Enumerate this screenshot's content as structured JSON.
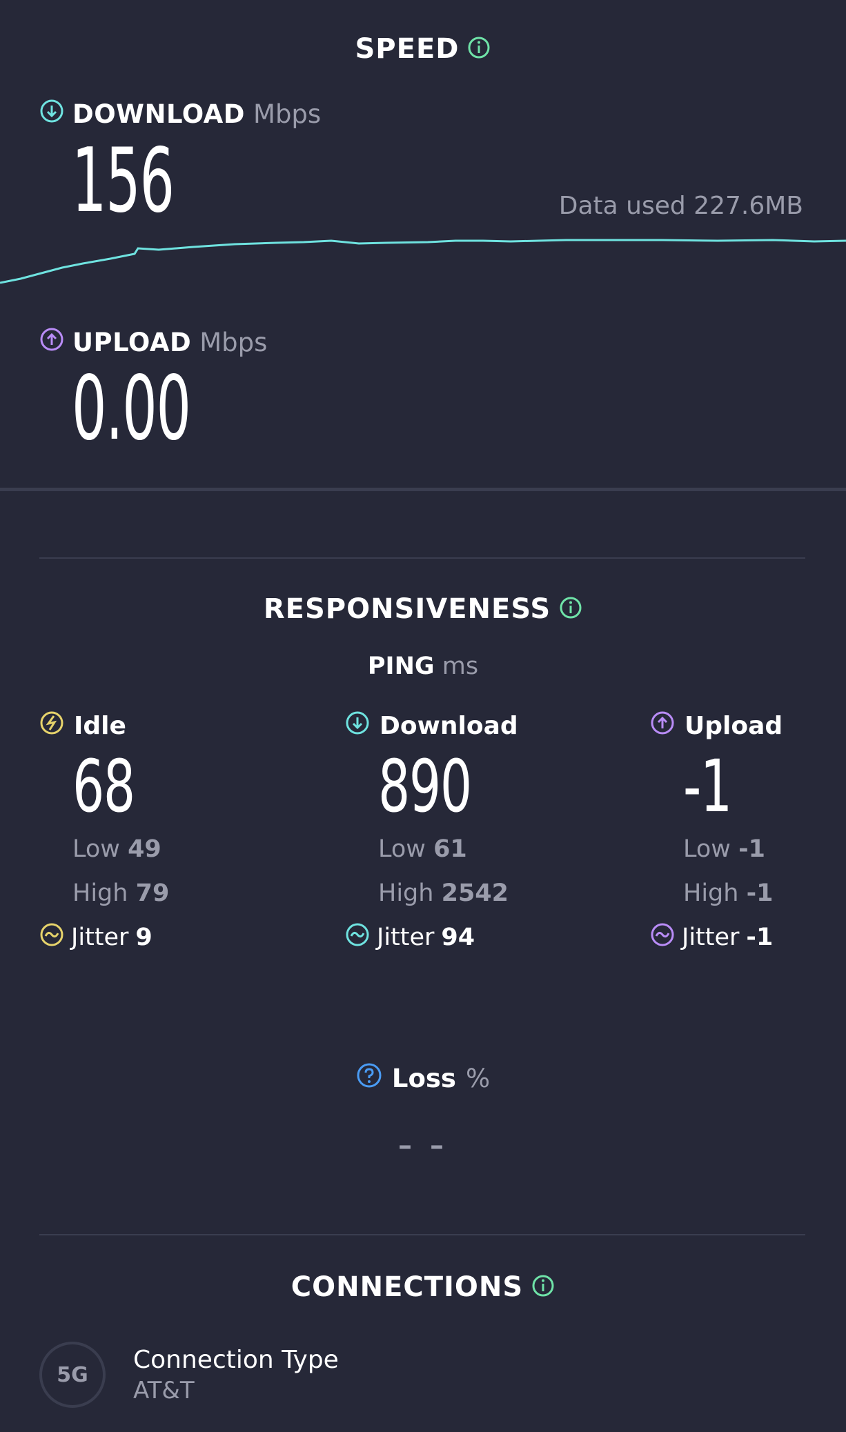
{
  "speed": {
    "title": "SPEED",
    "download": {
      "label": "DOWNLOAD",
      "unit": "Mbps",
      "value": "156",
      "data_used": "Data used 227.6MB"
    },
    "upload": {
      "label": "UPLOAD",
      "unit": "Mbps",
      "value": "0.00"
    }
  },
  "responsiveness": {
    "title": "RESPONSIVENESS",
    "ping_label": "PING",
    "ping_unit": "ms",
    "columns": [
      {
        "name": "Idle",
        "value": "68",
        "low_label": "Low",
        "low": "49",
        "high_label": "High",
        "high": "79",
        "jitter_label": "Jitter",
        "jitter": "9",
        "color": "#e6d36b",
        "icon": "lightning-icon"
      },
      {
        "name": "Download",
        "value": "890",
        "low_label": "Low",
        "low": "61",
        "high_label": "High",
        "high": "2542",
        "jitter_label": "Jitter",
        "jitter": "94",
        "color": "#6fe3e0",
        "icon": "arrow-down-icon"
      },
      {
        "name": "Upload",
        "value": "-1",
        "low_label": "Low",
        "low": "-1",
        "high_label": "High",
        "high": "-1",
        "jitter_label": "Jitter",
        "jitter": "-1",
        "color": "#b98cf7",
        "icon": "arrow-up-icon"
      }
    ],
    "loss": {
      "label": "Loss",
      "unit": "%",
      "value": "– –"
    }
  },
  "connections": {
    "title": "CONNECTIONS",
    "badge": "5G",
    "type_label": "Connection Type",
    "provider": "AT&T"
  },
  "colors": {
    "download_accent": "#6fe3e0",
    "upload_accent": "#b98cf7",
    "idle_accent": "#e6d36b",
    "loss_accent": "#4a9cf5"
  }
}
